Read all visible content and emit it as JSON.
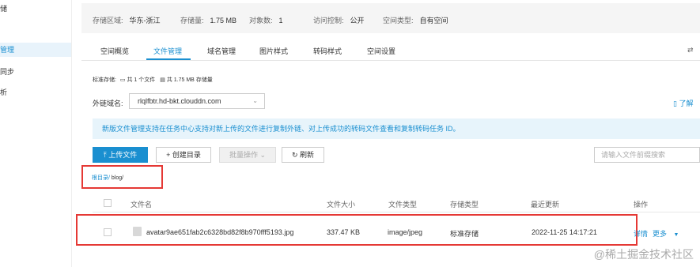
{
  "sidebar": {
    "items": [
      {
        "label": "储"
      },
      {
        "label": "管理"
      },
      {
        "label": "同步"
      },
      {
        "label": "析"
      }
    ]
  },
  "info": {
    "region_label": "存储区域:",
    "region_value": "华东-浙江",
    "storage_label": "存储量:",
    "storage_value": "1.75 MB",
    "objects_label": "对象数:",
    "objects_value": "1",
    "access_label": "访问控制:",
    "access_value": "公开",
    "space_type_label": "空间类型:",
    "space_type_value": "自有空间"
  },
  "tabs": [
    {
      "label": "空间概览"
    },
    {
      "label": "文件管理",
      "active": true
    },
    {
      "label": "域名管理"
    },
    {
      "label": "图片样式"
    },
    {
      "label": "转码样式"
    },
    {
      "label": "空间设置"
    }
  ],
  "tabs_right_icon": "settings-icon",
  "stats": {
    "standard_label": "标准存储:",
    "file_count": "共 1 个文件",
    "storage_total": "共 1.75 MB 存储量"
  },
  "domain": {
    "label": "外链域名:",
    "value": "rlqlfbtr.hd-bkt.clouddn.com",
    "help_link": "了解"
  },
  "notice": "新版文件管理支持在任务中心支持对新上传的文件进行复制外链、对上传成功的转码文件查看和复制转码任务 ID。",
  "toolbar": {
    "upload": "上传文件",
    "create_dir": "创建目录",
    "batch": "批量操作",
    "refresh": "刷新",
    "search_placeholder": "请输入文件前缀搜索"
  },
  "breadcrumb": {
    "root": "根目录/",
    "current": "blog/"
  },
  "table": {
    "headers": {
      "name": "文件名",
      "size": "文件大小",
      "type": "文件类型",
      "storage": "存储类型",
      "updated": "最近更新",
      "actions": "操作"
    },
    "rows": [
      {
        "name": "avatar9ae651fab2c6328bd82f8b970fff5193.jpg",
        "size": "337.47 KB",
        "type": "image/jpeg",
        "storage": "标准存储",
        "updated": "2022-11-25 14:17:21",
        "details": "详情",
        "more": "更多"
      }
    ]
  },
  "watermark": "@稀土掘金技术社区",
  "colors": {
    "accent": "#1a8fd0",
    "highlight_border": "#e53935",
    "notice_bg": "#e7f4fb"
  }
}
